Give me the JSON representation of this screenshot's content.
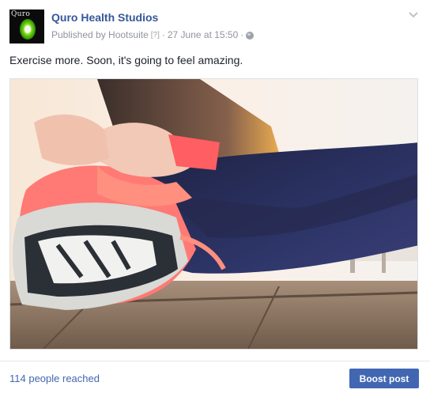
{
  "post": {
    "page_name": "Quro Health Studios",
    "logo_text": "Quro",
    "published_by": "Published by Hootsuite",
    "help_marker": "[?]",
    "separator": "·",
    "date": "27 June at 15:50",
    "separator2": "·",
    "audience_icon": "globe-icon",
    "menu_icon": "chevron-down-icon",
    "text": "Exercise more. Soon, it's going to feel amazing.",
    "image_subject": "photo"
  },
  "footer": {
    "reach": "114 people reached",
    "boost_label": "Boost post"
  },
  "colors": {
    "link_blue": "#365899",
    "button_blue": "#4267b2",
    "meta_gray": "#90949c"
  }
}
